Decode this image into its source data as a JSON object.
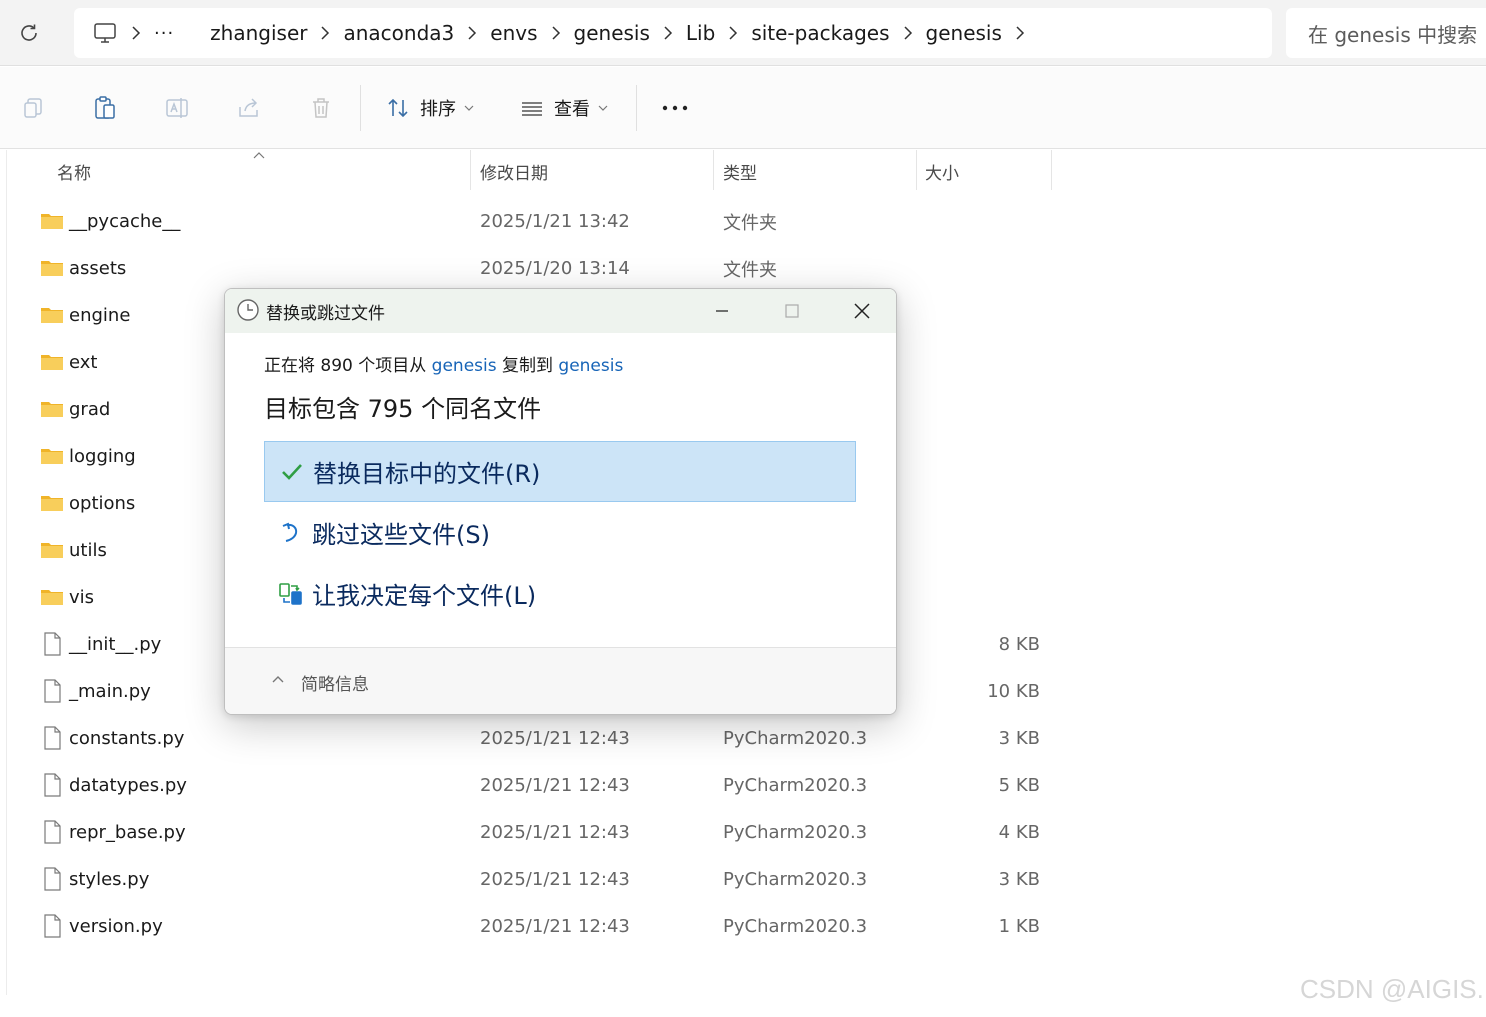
{
  "address_bar": {
    "breadcrumbs": [
      "zhangiser",
      "anaconda3",
      "envs",
      "genesis",
      "Lib",
      "site-packages",
      "genesis"
    ],
    "search_placeholder": "在 genesis 中搜索"
  },
  "toolbar": {
    "sort_label": "排序",
    "view_label": "查看"
  },
  "columns": {
    "name": "名称",
    "date": "修改日期",
    "type": "类型",
    "size": "大小"
  },
  "files": [
    {
      "icon": "folder-icon",
      "name": "__pycache__",
      "date": "2025/1/21 13:42",
      "type": "文件夹",
      "size": ""
    },
    {
      "icon": "folder-icon",
      "name": "assets",
      "date": "2025/1/20 13:14",
      "type": "文件夹",
      "size": ""
    },
    {
      "icon": "folder-icon",
      "name": "engine",
      "date": "",
      "type": "",
      "size": ""
    },
    {
      "icon": "folder-icon",
      "name": "ext",
      "date": "",
      "type": "",
      "size": ""
    },
    {
      "icon": "folder-icon",
      "name": "grad",
      "date": "",
      "type": "",
      "size": ""
    },
    {
      "icon": "folder-icon",
      "name": "logging",
      "date": "",
      "type": "",
      "size": ""
    },
    {
      "icon": "folder-icon",
      "name": "options",
      "date": "",
      "type": "",
      "size": ""
    },
    {
      "icon": "folder-icon",
      "name": "utils",
      "date": "",
      "type": "",
      "size": ""
    },
    {
      "icon": "folder-icon",
      "name": "vis",
      "date": "",
      "type": "",
      "size": ""
    },
    {
      "icon": "file-icon",
      "name": "__init__.py",
      "date": "",
      "type": "",
      "size": "8 KB"
    },
    {
      "icon": "file-icon",
      "name": "_main.py",
      "date": "",
      "type": "",
      "size": "10 KB"
    },
    {
      "icon": "file-icon",
      "name": "constants.py",
      "date": "2025/1/21 12:43",
      "type": "PyCharm2020.3",
      "size": "3 KB"
    },
    {
      "icon": "file-icon",
      "name": "datatypes.py",
      "date": "2025/1/21 12:43",
      "type": "PyCharm2020.3",
      "size": "5 KB"
    },
    {
      "icon": "file-icon",
      "name": "repr_base.py",
      "date": "2025/1/21 12:43",
      "type": "PyCharm2020.3",
      "size": "4 KB"
    },
    {
      "icon": "file-icon",
      "name": "styles.py",
      "date": "2025/1/21 12:43",
      "type": "PyCharm2020.3",
      "size": "3 KB"
    },
    {
      "icon": "file-icon",
      "name": "version.py",
      "date": "2025/1/21 12:43",
      "type": "PyCharm2020.3",
      "size": "1 KB"
    }
  ],
  "dialog": {
    "title": "替换或跳过文件",
    "msg_prefix": "正在将 890 个项目从 ",
    "msg_source": "genesis",
    "msg_middle": " 复制到 ",
    "msg_dest": "genesis",
    "heading": "目标包含 795 个同名文件",
    "options": [
      {
        "icon": "checkmark-icon",
        "label": "替换目标中的文件(R)",
        "selected": true
      },
      {
        "icon": "skip-arrow-icon",
        "label": "跳过这些文件(S)",
        "selected": false
      },
      {
        "icon": "compare-files-icon",
        "label": "让我决定每个文件(L)",
        "selected": false
      }
    ],
    "footer_label": "简略信息"
  },
  "watermark": "CSDN @AIGIS.",
  "colors": {
    "selected_option_bg": "#cce4f7",
    "link": "#1764b7",
    "folder": "#f5c242",
    "check": "#2f9e44"
  }
}
